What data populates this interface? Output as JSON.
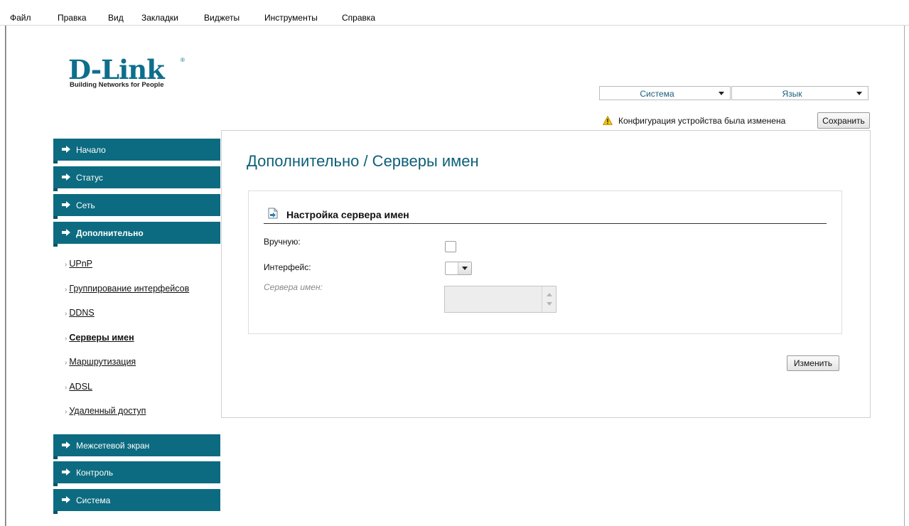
{
  "browser_menu": [
    {
      "label": "Файл",
      "name": "menu-file"
    },
    {
      "label": "Правка",
      "name": "menu-edit"
    },
    {
      "label": "Вид",
      "name": "menu-view"
    },
    {
      "label": "Закладки",
      "name": "menu-bookmarks"
    },
    {
      "label": "Виджеты",
      "name": "menu-widgets"
    },
    {
      "label": "Инструменты",
      "name": "menu-tools"
    },
    {
      "label": "Справка",
      "name": "menu-help"
    }
  ],
  "logo": {
    "brand": "D-Link",
    "registered": "®",
    "tagline": "Building Networks for People"
  },
  "header": {
    "system_select": "Система",
    "language_select": "Язык",
    "notice": "Конфигурация устройства была изменена",
    "save_button": "Сохранить"
  },
  "sidebar": {
    "top_items": [
      {
        "label": "Начало"
      },
      {
        "label": "Статус"
      },
      {
        "label": "Сеть"
      },
      {
        "label": "Дополнительно",
        "active": true
      }
    ],
    "sub_items": [
      {
        "label": "UPnP"
      },
      {
        "label": "Группирование интерфейсов"
      },
      {
        "label": "DDNS"
      },
      {
        "label": "Серверы имен",
        "active": true
      },
      {
        "label": "Маршрутизация"
      },
      {
        "label": "ADSL"
      },
      {
        "label": "Удаленный доступ"
      }
    ],
    "bottom_items": [
      {
        "label": "Межсетевой экран"
      },
      {
        "label": "Контроль"
      },
      {
        "label": "Система"
      }
    ]
  },
  "main": {
    "page_title": "Дополнительно /  Серверы имен",
    "section_title": "Настройка сервера имен",
    "fields": {
      "manual_label": "Вручную:",
      "manual_checked": false,
      "interface_label": "Интерфейс:",
      "interface_value": "",
      "nameservers_label": "Сервера имен:",
      "nameservers_value": ""
    },
    "apply_button": "Изменить"
  },
  "colors": {
    "nav_teal": "#0c6b80",
    "title_blue": "#0e5f78",
    "warning_yellow": "#f2c200"
  },
  "icons": {
    "nav_arrow": "arrow-right-icon",
    "warning": "warning-triangle-icon",
    "section": "document-arrow-icon"
  }
}
